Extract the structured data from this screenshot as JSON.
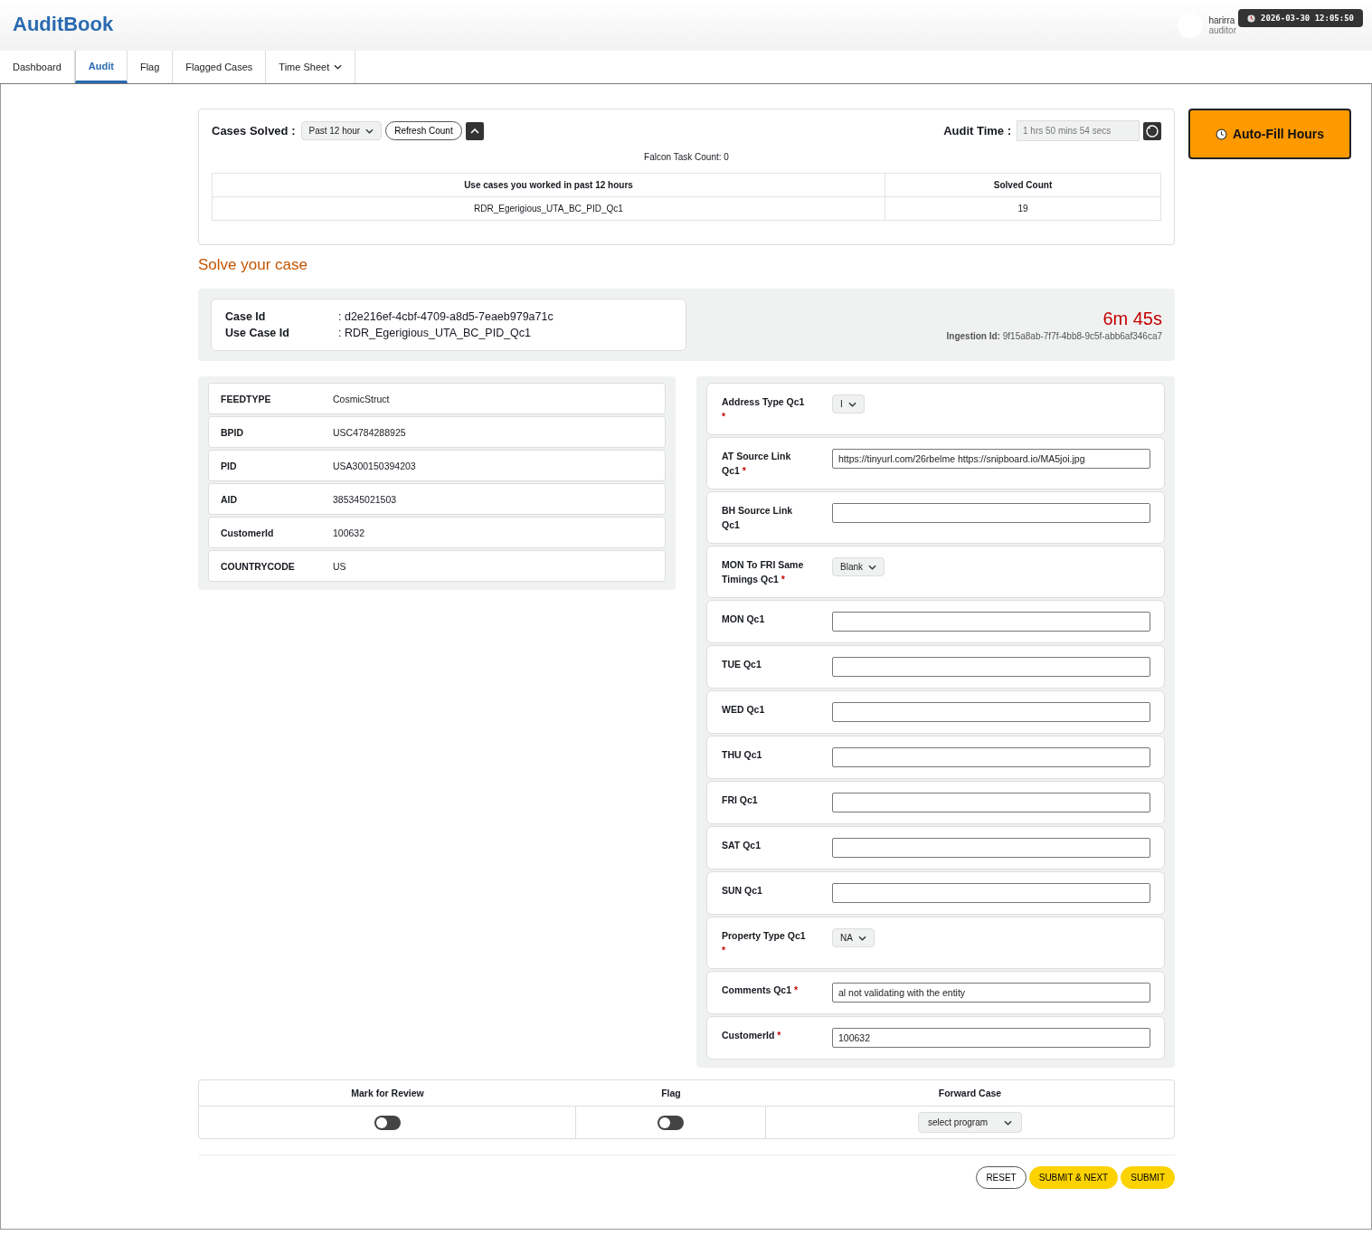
{
  "header": {
    "logo": "AuditBook",
    "user": {
      "name": "harirra",
      "role": "auditor"
    },
    "tooltip": {
      "text": "2026-03-30 12:05:50"
    }
  },
  "tabs": [
    {
      "label": "Dashboard",
      "selected": false,
      "kind": "tab"
    },
    {
      "label": "Audit",
      "selected": true,
      "kind": "tab"
    },
    {
      "label": "Flag",
      "selected": false,
      "kind": "tab"
    },
    {
      "label": "Flagged Cases",
      "selected": false,
      "kind": "tab"
    },
    {
      "label": "Time Sheet",
      "selected": false,
      "kind": "menu"
    }
  ],
  "stats": {
    "cases_label": "Cases Solved :",
    "period": "Past 12 hour",
    "refresh": "Refresh Count",
    "audit_label": "Audit Time :",
    "audit_time": "1 hrs 50 mins 54 secs",
    "falcon": "Falcon Task Count: 0",
    "columns": [
      "Use cases you worked in past 12 hours",
      "Solved Count"
    ],
    "rows": [
      [
        "RDR_Egerigious_UTA_BC_PID_Qc1",
        "19"
      ]
    ]
  },
  "autofill": "Auto-Fill Hours",
  "section_title": "Solve your case",
  "case": {
    "fields": [
      {
        "label": "Case Id",
        "value": ": d2e216ef-4cbf-4709-a8d5-7eaeb979a71c"
      },
      {
        "label": "Use Case Id",
        "value": ": RDR_Egerigious_UTA_BC_PID_Qc1"
      }
    ],
    "timer": "6m 45s",
    "ingestion_label": "Ingestion Id:",
    "ingestion_id": "9f15a8ab-7f7f-4bb8-9c5f-abb6af346ca7"
  },
  "details": [
    {
      "label": "FEEDTYPE",
      "value": "CosmicStruct"
    },
    {
      "label": "BPID",
      "value": "USC4784288925"
    },
    {
      "label": "PID",
      "value": "USA300150394203"
    },
    {
      "label": "AID",
      "value": "385345021503"
    },
    {
      "label": "CustomerId",
      "value": "100632"
    },
    {
      "label": "COUNTRYCODE",
      "value": "US"
    }
  ],
  "form": [
    {
      "label": "Address Type Qc1",
      "required_mark": "*",
      "kind": "select",
      "value": "I"
    },
    {
      "label": "AT Source Link Qc1",
      "required_mark": "*",
      "kind": "input",
      "value": "https://tinyurl.com/26rbelme https://snipboard.io/MA5joi.jpg"
    },
    {
      "label": "BH Source Link Qc1",
      "kind": "input"
    },
    {
      "label": "MON To FRI Same Timings Qc1",
      "required_mark": "*",
      "kind": "select",
      "value": "Blank"
    },
    {
      "label": "MON Qc1",
      "kind": "input"
    },
    {
      "label": "TUE Qc1",
      "kind": "input"
    },
    {
      "label": "WED Qc1",
      "kind": "input"
    },
    {
      "label": "THU Qc1",
      "kind": "input"
    },
    {
      "label": "FRI Qc1",
      "kind": "input"
    },
    {
      "label": "SAT Qc1",
      "kind": "input"
    },
    {
      "label": "SUN Qc1",
      "kind": "input"
    },
    {
      "label": "Property Type Qc1",
      "required_mark": "*",
      "kind": "select",
      "value": "NA"
    },
    {
      "label": "Comments Qc1",
      "required_mark": "*",
      "kind": "input",
      "value": "al not validating with the entity"
    },
    {
      "label": "CustomerId",
      "required_mark": "*",
      "kind": "input",
      "value": "100632"
    }
  ],
  "actions": [
    {
      "label": "Mark for Review",
      "kind": "toggle",
      "on": false
    },
    {
      "label": "Flag",
      "kind": "toggle",
      "on": false
    },
    {
      "label": "Forward Case",
      "kind": "select",
      "value": "select program"
    }
  ],
  "buttons": [
    {
      "label": "RESET",
      "kind": "outline"
    },
    {
      "label": "SUBMIT & NEXT",
      "kind": "primary"
    },
    {
      "label": "SUBMIT",
      "kind": "primary"
    }
  ]
}
